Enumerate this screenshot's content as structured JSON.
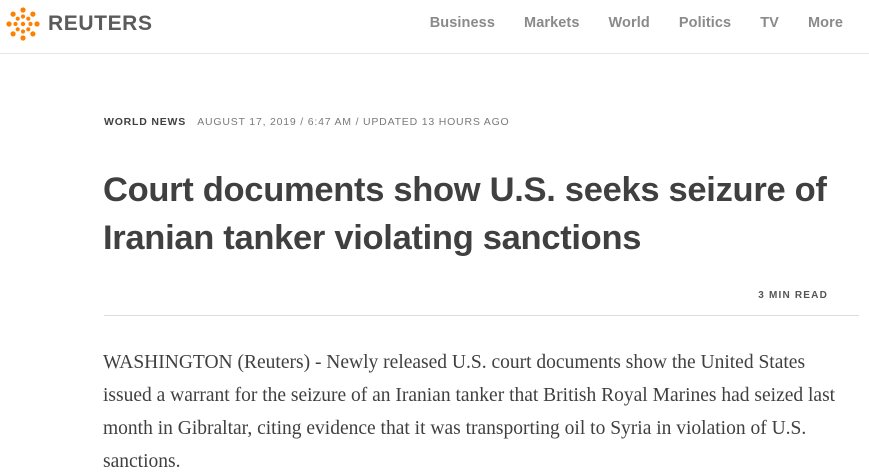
{
  "header": {
    "brand": "REUTERS",
    "logo_icon": "reuters-dots-logo",
    "nav": [
      {
        "label": "Business"
      },
      {
        "label": "Markets"
      },
      {
        "label": "World"
      },
      {
        "label": "Politics"
      },
      {
        "label": "TV"
      },
      {
        "label": "More"
      }
    ]
  },
  "article": {
    "section": "WORLD NEWS",
    "dateline": "AUGUST 17, 2019 / 6:47 AM / UPDATED 13 HOURS AGO",
    "headline": "Court documents show U.S. seeks seizure of Iranian tanker violating sanctions",
    "read_time": "3 MIN READ",
    "body": "WASHINGTON (Reuters) - Newly released U.S. court documents show the United States issued a warrant for the seizure of an Iranian tanker that British Royal Marines had seized last month in Gibraltar, citing evidence that it was transporting oil to Syria in violation of U.S. sanctions."
  },
  "colors": {
    "brand_orange": "#ff8000",
    "text": "#404040",
    "nav_text": "#8a8a8a"
  }
}
